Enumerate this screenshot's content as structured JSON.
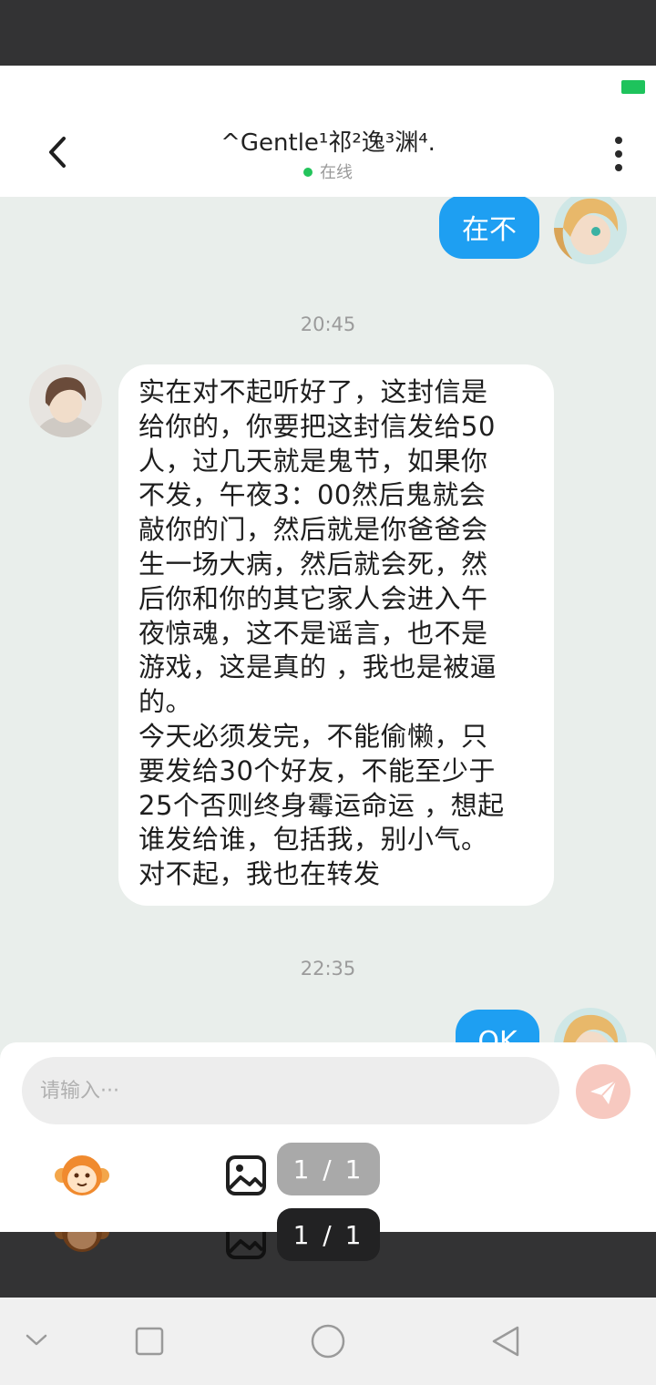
{
  "header": {
    "title": "^Gentle¹祁²逸³渊⁴.",
    "status": "在线"
  },
  "messages": {
    "outgoing_1": "在不",
    "time_1": "20:45",
    "incoming_1": "实在对不起听好了，这封信是\n给你的，你要把这封信发给50\n人，过几天就是鬼节，如果你\n不发，午夜3：00然后鬼就会\n敲你的门，然后就是你爸爸会\n生一场大病，然后就会死，然\n后你和你的其它家人会进入午\n夜惊魂，这不是谣言，也不是\n游戏，这是真的 ，我也是被逼\n的。\n今天必须发完，不能偷懒，只\n要发给30个好友，不能至少于\n25个否则终身霉运命运 ，想起\n谁发给谁，包括我，别小气。\n对不起，我也在转发",
    "time_2": "22:35",
    "outgoing_2": "OK"
  },
  "input": {
    "placeholder": "请输入···"
  },
  "pager": {
    "label": "1 / 1"
  },
  "icons": {
    "back": "back-arrow-icon",
    "more": "more-vertical-icon",
    "send": "paper-plane-icon",
    "emoji": "monkey-emoji-icon",
    "image": "image-icon",
    "nav_down": "chevron-down-icon",
    "nav_recent": "square-icon",
    "nav_home": "circle-icon",
    "nav_back": "triangle-back-icon"
  },
  "colors": {
    "outgoing_bubble": "#1e9ff2",
    "online_dot": "#23c45b",
    "battery": "#1ec35c",
    "send_button": "#f7c9c0"
  }
}
